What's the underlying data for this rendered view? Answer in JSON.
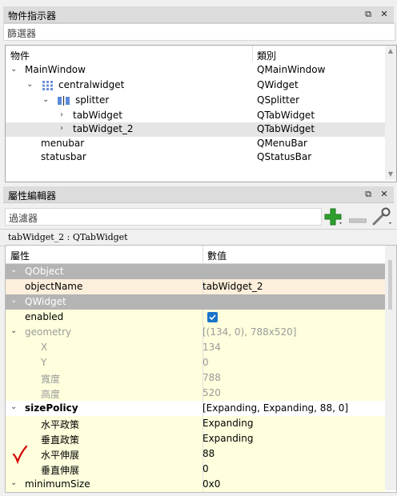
{
  "object_inspector": {
    "title": "物件指示器",
    "filter_placeholder": "篩選器",
    "col_object": "物件",
    "col_class": "類別",
    "rows": [
      {
        "name": "MainWindow",
        "cls": "QMainWindow"
      },
      {
        "name": "centralwidget",
        "cls": "QWidget"
      },
      {
        "name": "splitter",
        "cls": "QSplitter"
      },
      {
        "name": "tabWidget",
        "cls": "QTabWidget"
      },
      {
        "name": "tabWidget_2",
        "cls": "QTabWidget"
      },
      {
        "name": "menubar",
        "cls": "QMenuBar"
      },
      {
        "name": "statusbar",
        "cls": "QStatusBar"
      }
    ]
  },
  "property_editor": {
    "title": "屬性編輯器",
    "filter_placeholder": "過濾器",
    "object_label": "tabWidget_2 : QTabWidget",
    "col_property": "屬性",
    "col_value": "數值",
    "rows": [
      {
        "name": "QObject",
        "value": ""
      },
      {
        "name": "objectName",
        "value": "tabWidget_2"
      },
      {
        "name": "QWidget",
        "value": ""
      },
      {
        "name": "enabled",
        "value": ""
      },
      {
        "name": "geometry",
        "value": "[(134, 0), 788x520]"
      },
      {
        "name": "X",
        "value": "134"
      },
      {
        "name": "Y",
        "value": "0"
      },
      {
        "name": "寬度",
        "value": "788"
      },
      {
        "name": "高度",
        "value": "520"
      },
      {
        "name": "sizePolicy",
        "value": "[Expanding, Expanding, 88, 0]"
      },
      {
        "name": "水平政策",
        "value": "Expanding"
      },
      {
        "name": "垂直政策",
        "value": "Expanding"
      },
      {
        "name": "水平伸展",
        "value": "88"
      },
      {
        "name": "垂直伸展",
        "value": "0"
      },
      {
        "name": "minimumSize",
        "value": "0x0"
      }
    ],
    "enabled_checked": true
  },
  "colors": {
    "category_bg": "#b4b4b4",
    "highlight_row": "#fcefdb",
    "property_row": "#ffffdd",
    "checkmark": "#d60000",
    "add_icon": "#2e9f2e"
  }
}
